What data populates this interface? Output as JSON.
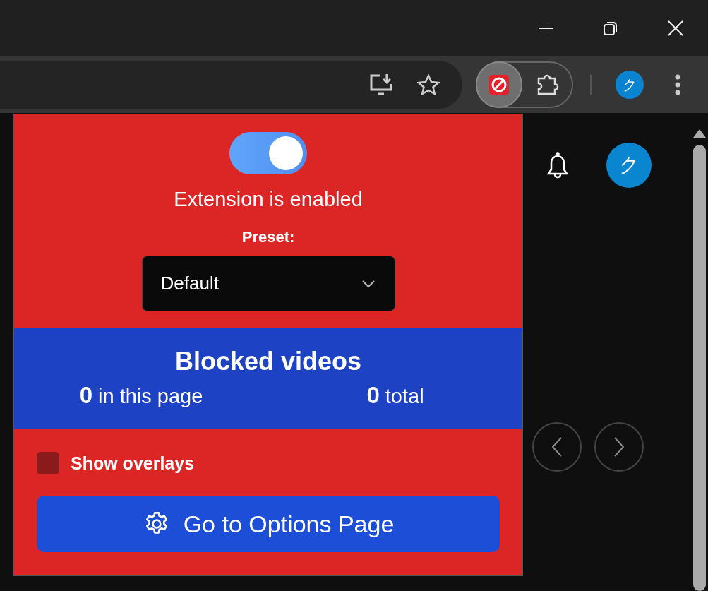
{
  "browser": {
    "profile_initial": "ク",
    "extension_active": true
  },
  "page": {
    "avatar_initial": "ク"
  },
  "popup": {
    "toggle": {
      "on": true
    },
    "status": "Extension is enabled",
    "preset_label": "Preset:",
    "preset": {
      "value": "Default"
    },
    "blocked": {
      "title": "Blocked videos",
      "stats": [
        {
          "count": "0",
          "label": "in this page"
        },
        {
          "count": "0",
          "label": "total"
        }
      ]
    },
    "overlays": {
      "label": "Show overlays",
      "checked": false
    },
    "options_button": "Go to Options Page"
  }
}
